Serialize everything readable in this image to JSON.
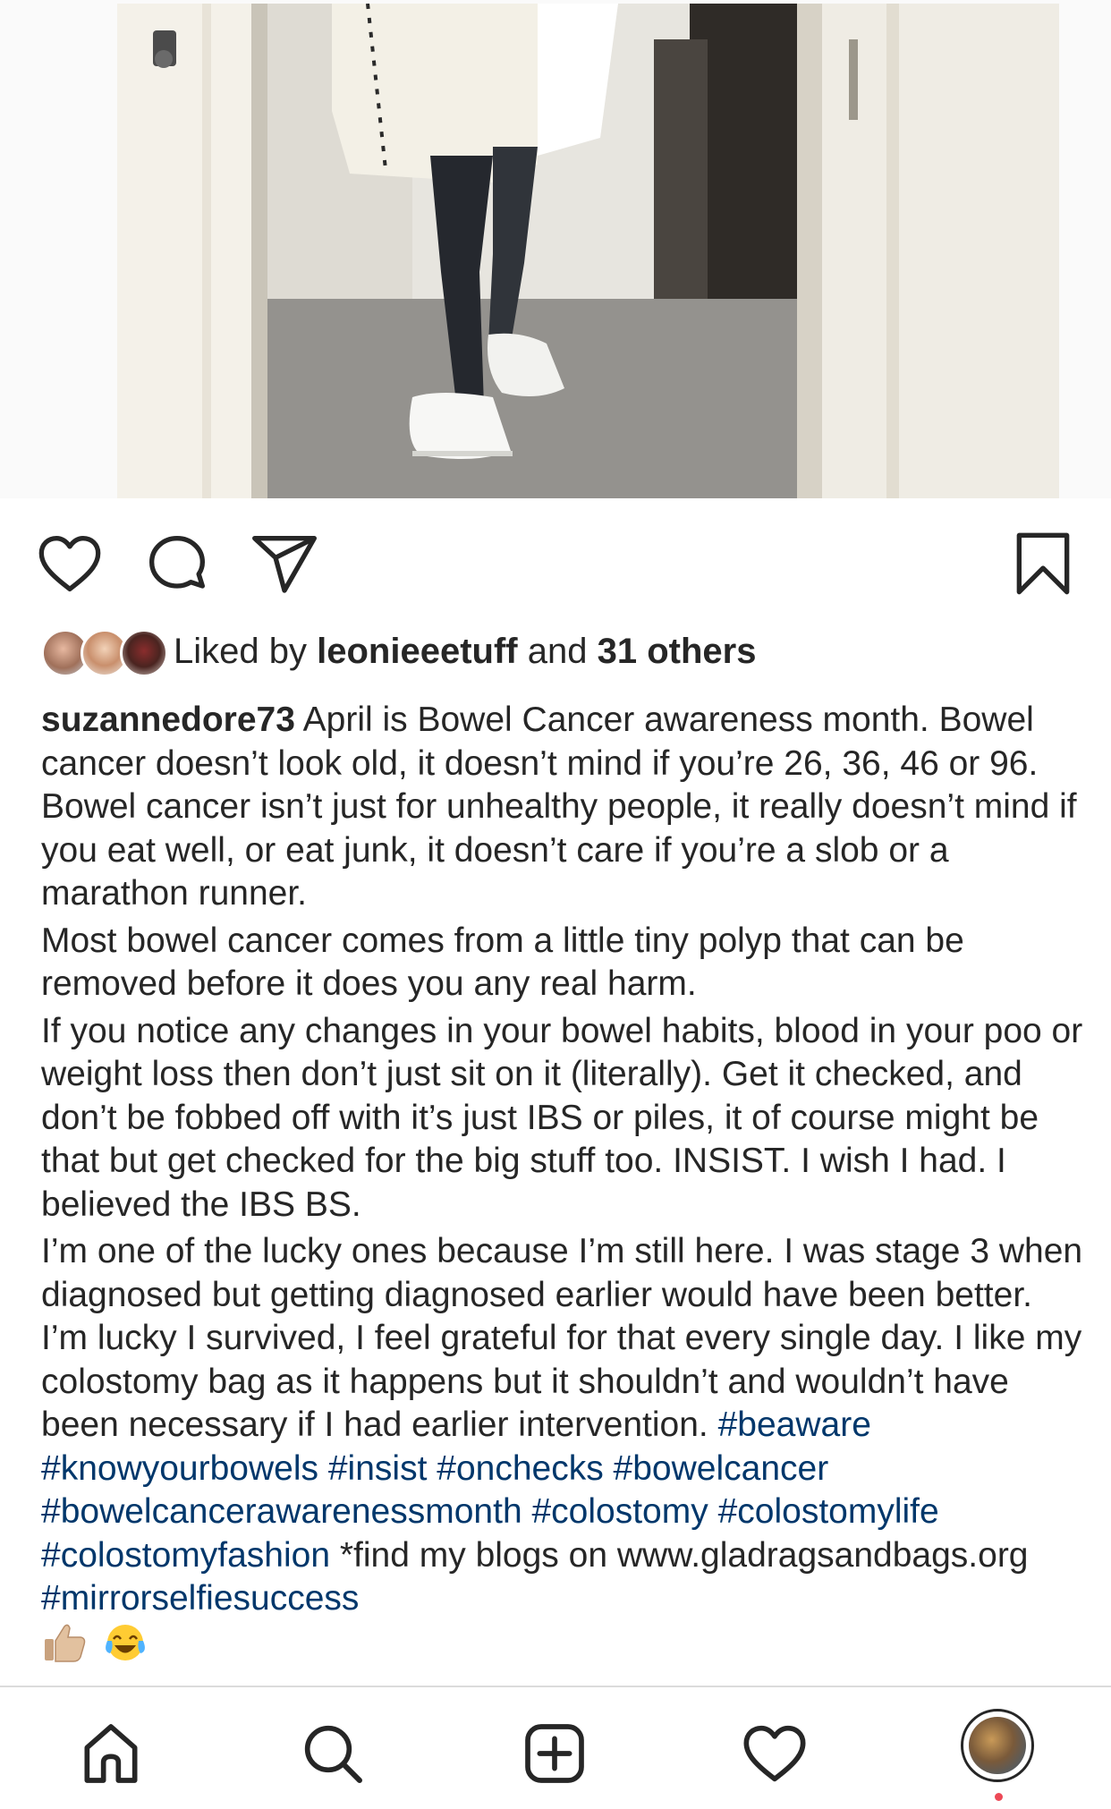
{
  "post": {
    "photo_alt": "",
    "liked_by_prefix": "Liked by",
    "liked_by_user": "leonieeetuff",
    "liked_by_and": "and",
    "liked_by_others": "31 others",
    "caption_username": "suzannedore73",
    "caption_p1": "April is Bowel Cancer awareness month. Bowel cancer doesn’t look old, it doesn’t mind if you’re 26, 36, 46 or 96. Bowel cancer isn’t just for unhealthy people, it really doesn’t mind if you eat well, or eat junk, it doesn’t care if you’re a slob or a marathon runner.",
    "caption_p2": "Most bowel cancer comes from a little tiny polyp that can be removed before it does you any real harm.",
    "caption_p3": "If you notice any changes in your bowel habits, blood in your poo or weight loss then don’t just sit on it (literally). Get it checked, and don’t be fobbed off with it’s just IBS or piles, it of course might be that but get checked for the big stuff too. INSIST. I wish I had. I believed the IBS BS.",
    "caption_p4": "I’m one of the lucky ones because I’m still here. I was stage 3 when diagnosed but getting diagnosed earlier would have been better. I’m lucky I survived, I feel grateful for that every single day. I like my colostomy bag as it happens but it shouldn’t and wouldn’t have been necessary if I had earlier intervention.",
    "hashtags_1": [
      "#beaware",
      "#knowyourbowels",
      "#insist",
      "#onchecks",
      "#bowelcancer",
      "#bowelcancerawarenessmonth",
      "#colostomy",
      "#colostomylife",
      "#colostomyfashion"
    ],
    "caption_find": "*find my blogs on",
    "caption_link": "www.gladragsandbags.org",
    "hashtags_2": [
      "#mirrorselfiesuccess"
    ],
    "emojis": [
      "thumbs-up-emoji",
      "tears-of-joy-emoji"
    ]
  },
  "actions": {
    "like": "heart-icon",
    "comment": "comment-icon",
    "share": "paper-plane-icon",
    "save": "bookmark-icon"
  },
  "tabbar": {
    "items": [
      "home-icon",
      "search-icon",
      "new-post-icon",
      "activity-heart-icon",
      "profile-avatar"
    ]
  },
  "colors": {
    "text": "#262626",
    "hashtag": "#00376b",
    "divider": "#dbdbdb",
    "notification": "#ed4956"
  }
}
